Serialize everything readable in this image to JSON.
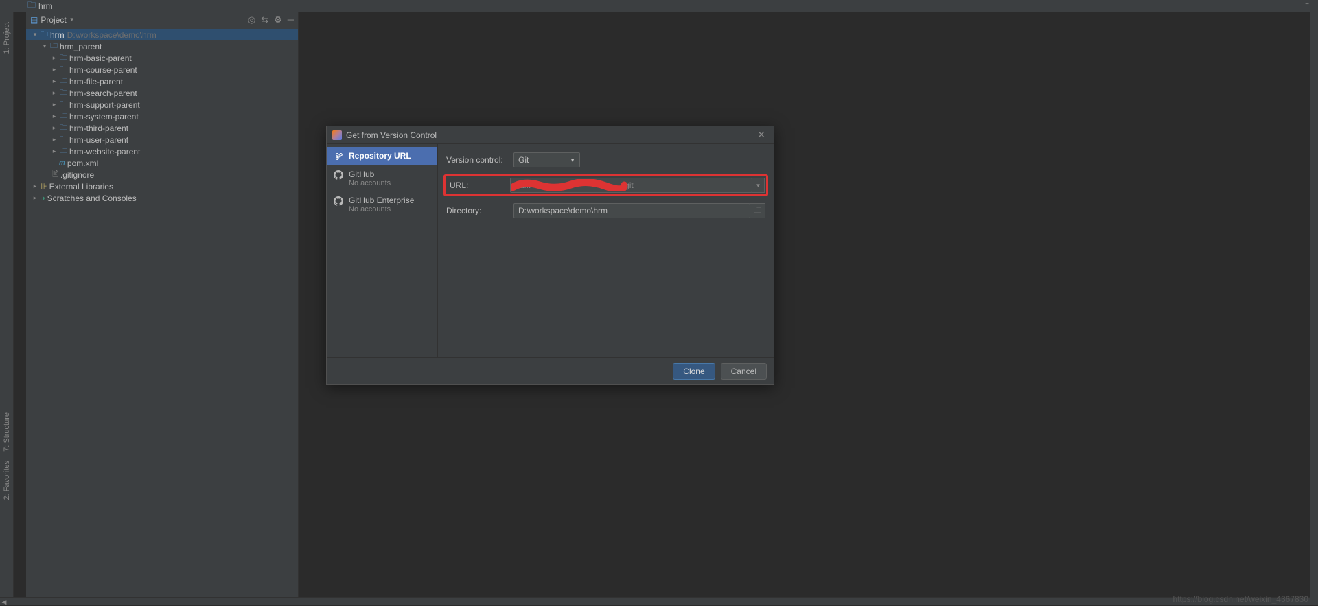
{
  "breadcrumb": {
    "root": "hrm"
  },
  "gutters": {
    "project": "1: Project",
    "structure": "7: Structure",
    "favorites": "2: Favorites"
  },
  "projectPanel": {
    "title": "Project",
    "tree": {
      "root": {
        "label": "hrm",
        "path": "D:\\workspace\\demo\\hrm"
      },
      "parent": "hrm_parent",
      "modules": [
        "hrm-basic-parent",
        "hrm-course-parent",
        "hrm-file-parent",
        "hrm-search-parent",
        "hrm-support-parent",
        "hrm-system-parent",
        "hrm-third-parent",
        "hrm-user-parent",
        "hrm-website-parent"
      ],
      "pom": "pom.xml",
      "gitignore": ".gitignore",
      "externalLibs": "External Libraries",
      "scratches": "Scratches and Consoles"
    }
  },
  "dialog": {
    "title": "Get from Version Control",
    "sidebar": {
      "items": [
        {
          "title": "Repository URL",
          "sub": ""
        },
        {
          "title": "GitHub",
          "sub": "No accounts"
        },
        {
          "title": "GitHub Enterprise",
          "sub": "No accounts"
        }
      ]
    },
    "form": {
      "versionControlLabel": "Version control:",
      "versionControlValue": "Git",
      "urlLabel": "URL:",
      "urlValue": "htt...                                        .git",
      "directoryLabel": "Directory:",
      "directoryValue": "D:\\workspace\\demo\\hrm"
    },
    "buttons": {
      "clone": "Clone",
      "cancel": "Cancel"
    }
  },
  "watermark": "https://blog.csdn.net/weixin_4367830"
}
